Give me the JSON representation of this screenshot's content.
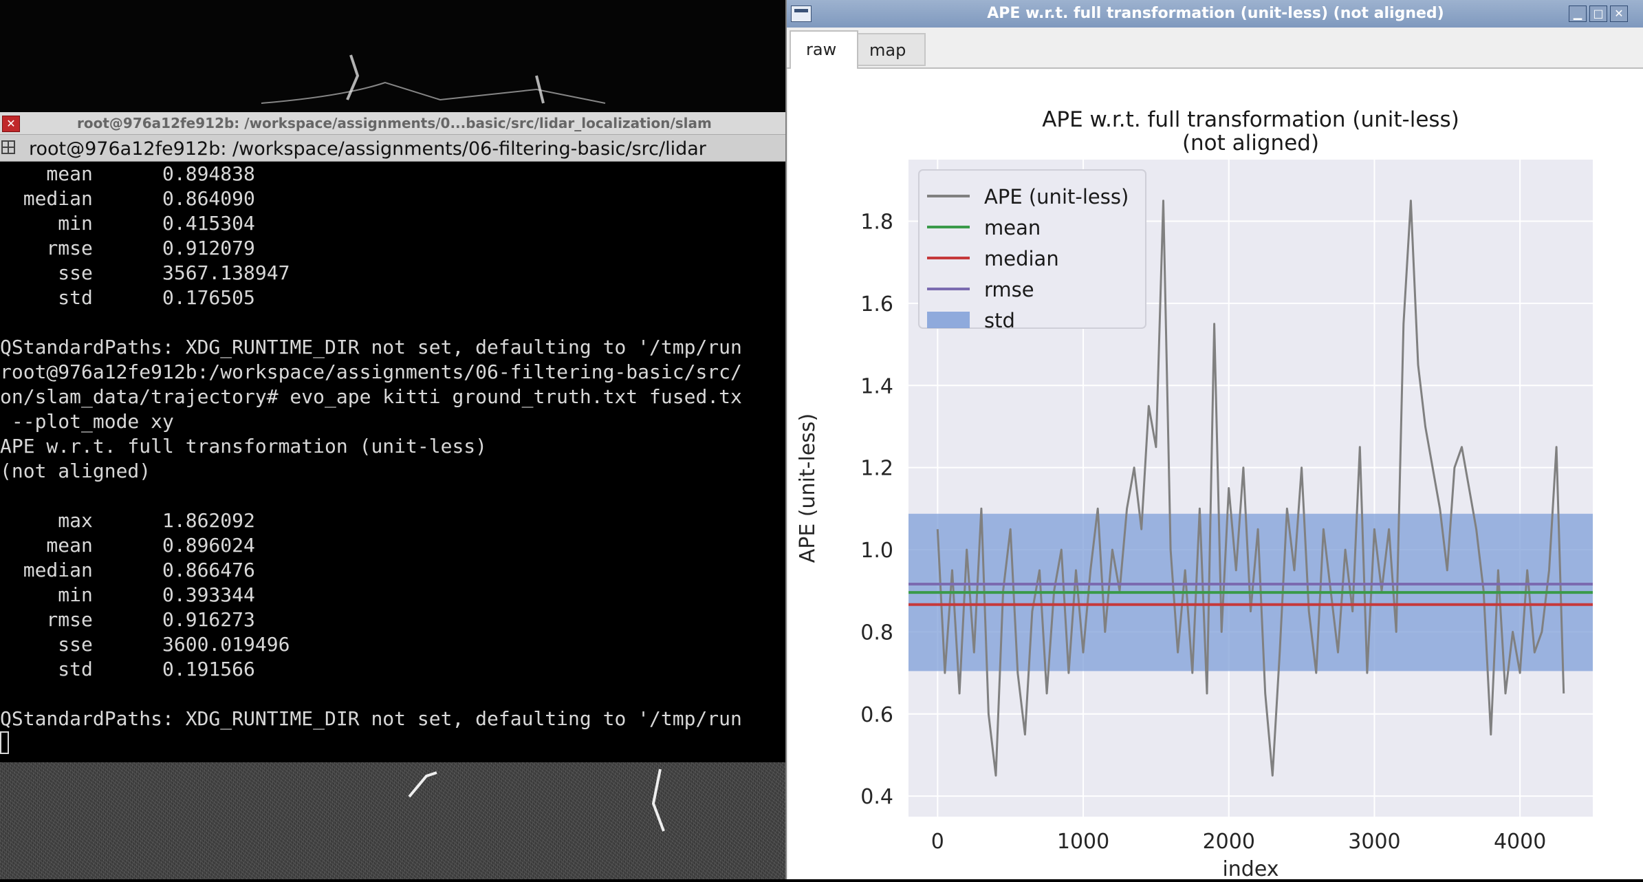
{
  "terminal": {
    "window_title": "root@976a12fe912b: /workspace/assignments/0...basic/src/lidar_localization/slam",
    "tab_title": "root@976a12fe912b: /workspace/assignments/06-filtering-basic/src/lidar",
    "lines": [
      "    mean      0.894838",
      "  median      0.864090",
      "     min      0.415304",
      "    rmse      0.912079",
      "     sse      3567.138947",
      "     std      0.176505",
      "",
      "QStandardPaths: XDG_RUNTIME_DIR not set, defaulting to '/tmp/run",
      "root@976a12fe912b:/workspace/assignments/06-filtering-basic/src/",
      "on/slam_data/trajectory# evo_ape kitti ground_truth.txt fused.tx",
      " --plot_mode xy",
      "APE w.r.t. full transformation (unit-less)",
      "(not aligned)",
      "",
      "     max      1.862092",
      "    mean      0.896024",
      "  median      0.866476",
      "     min      0.393344",
      "    rmse      0.916273",
      "     sse      3600.019496",
      "     std      0.191566",
      "",
      "QStandardPaths: XDG_RUNTIME_DIR not set, defaulting to '/tmp/run"
    ]
  },
  "plot_window": {
    "title": "APE w.r.t. full transformation (unit-less) (not aligned)",
    "tabs": [
      "raw",
      "map"
    ],
    "active_tab": "raw"
  },
  "chart_data": {
    "type": "line",
    "title": "APE w.r.t. full transformation (unit-less)",
    "subtitle": "(not aligned)",
    "xlabel": "index",
    "ylabel": "APE (unit-less)",
    "xlim": [
      -200,
      4500
    ],
    "ylim": [
      0.35,
      1.95
    ],
    "xticks": [
      0,
      1000,
      2000,
      3000,
      4000
    ],
    "yticks": [
      0.4,
      0.6,
      0.8,
      1.0,
      1.2,
      1.4,
      1.6,
      1.8
    ],
    "grid": true,
    "legend_position": "upper-left",
    "series": [
      {
        "name": "APE (unit-less)",
        "color": "#808080",
        "x": [
          0,
          50,
          100,
          150,
          200,
          250,
          300,
          350,
          400,
          450,
          500,
          550,
          600,
          650,
          700,
          750,
          800,
          850,
          900,
          950,
          1000,
          1050,
          1100,
          1150,
          1200,
          1250,
          1300,
          1350,
          1400,
          1450,
          1500,
          1550,
          1600,
          1650,
          1700,
          1750,
          1800,
          1850,
          1900,
          1950,
          2000,
          2050,
          2100,
          2150,
          2200,
          2250,
          2300,
          2350,
          2400,
          2450,
          2500,
          2550,
          2600,
          2650,
          2700,
          2750,
          2800,
          2850,
          2900,
          2950,
          3000,
          3050,
          3100,
          3150,
          3200,
          3250,
          3300,
          3350,
          3400,
          3450,
          3500,
          3550,
          3600,
          3650,
          3700,
          3750,
          3800,
          3850,
          3900,
          3950,
          4000,
          4050,
          4100,
          4150,
          4200,
          4250,
          4300
        ],
        "values": [
          1.05,
          0.7,
          0.95,
          0.65,
          1.0,
          0.75,
          1.1,
          0.6,
          0.45,
          0.9,
          1.05,
          0.7,
          0.55,
          0.85,
          0.95,
          0.65,
          0.9,
          1.0,
          0.7,
          0.95,
          0.75,
          0.95,
          1.1,
          0.8,
          1.0,
          0.9,
          1.1,
          1.2,
          1.05,
          1.35,
          1.25,
          1.85,
          1.0,
          0.75,
          0.95,
          0.7,
          1.1,
          0.65,
          1.55,
          0.8,
          1.15,
          0.95,
          1.2,
          0.85,
          1.05,
          0.65,
          0.45,
          0.75,
          1.1,
          0.95,
          1.2,
          0.85,
          0.7,
          1.05,
          0.9,
          0.75,
          1.0,
          0.85,
          1.25,
          0.7,
          1.05,
          0.9,
          1.05,
          0.8,
          1.55,
          1.85,
          1.45,
          1.3,
          1.2,
          1.1,
          0.95,
          1.2,
          1.25,
          1.15,
          1.05,
          0.9,
          0.55,
          0.95,
          0.65,
          0.8,
          0.7,
          0.95,
          0.75,
          0.8,
          0.95,
          1.25,
          0.65
        ]
      },
      {
        "name": "mean",
        "color": "#3a9a4a",
        "value": 0.896024
      },
      {
        "name": "median",
        "color": "#c6393b",
        "value": 0.866476
      },
      {
        "name": "rmse",
        "color": "#7b6bb0",
        "value": 0.916273
      },
      {
        "name": "std",
        "color": "#7f9fd8",
        "value": 0.191566
      }
    ]
  }
}
